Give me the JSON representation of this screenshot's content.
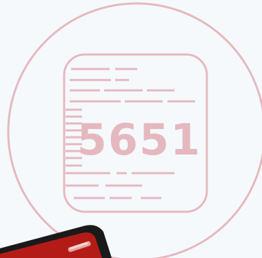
{
  "illustration": {
    "code": "5651",
    "colors": {
      "background": "#f5f9fb",
      "stroke": "#e5b8bf",
      "device_red": "#b31c16",
      "device_dark": "#1a1a1a"
    },
    "icons": {
      "circle": "circle-outline",
      "card": "rounded-card-outline",
      "device": "phone-device"
    }
  }
}
